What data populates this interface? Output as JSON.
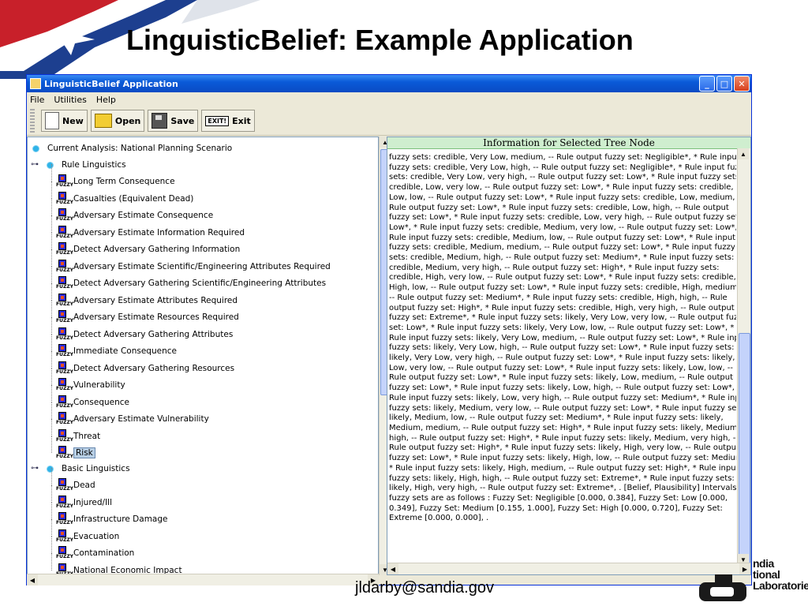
{
  "slide": {
    "title": "LinguisticBelief: Example Application",
    "footer_email": "jldarby@sandia.gov",
    "logo_text": [
      "ndia",
      "tional",
      "Laboratories"
    ]
  },
  "window": {
    "title": "LinguisticBelief Application",
    "menus": [
      "File",
      "Utilities",
      "Help"
    ],
    "toolbar": {
      "new_label": "New",
      "open_label": "Open",
      "save_label": "Save",
      "exit_icon_text": "EXIT!",
      "exit_label": "Exit"
    }
  },
  "tree": {
    "root": "Current Analysis: National Planning Scenario",
    "rule_group": "Rule Linguistics",
    "icon_text": "FUZZY",
    "rule_items": [
      "Long Term Consequence",
      "Casualties (Equivalent Dead)",
      "Adversary Estimate Consequence",
      "Adversary Estimate Information Required",
      "Detect Adversary Gathering Information",
      "Adversary Estimate Scientific/Engineering Attributes Required",
      "Detect Adversary Gathering Scientific/Engineering Attributes",
      "Adversary Estimate Attributes Required",
      "Adversary Estimate Resources Required",
      "Detect Adversary Gathering Attributes",
      "Immediate Consequence",
      "Detect Adversary Gathering Resources",
      "Vulnerability",
      "Consequence",
      "Adversary Estimate Vulnerability",
      "Threat",
      "Risk"
    ],
    "basic_group": "Basic Linguistics",
    "basic_items": [
      "Dead",
      "Injured/Ill",
      "Infrastructure Damage",
      "Evacuation",
      "Contamination",
      "National Economic Impact"
    ]
  },
  "info": {
    "header": "Information for Selected Tree Node",
    "lines": [
      "fuzzy sets: credible, Very Low, medium, -- Rule output fuzzy set: Negligible*, * Rule input",
      "fuzzy sets: credible, Very Low, high, -- Rule output fuzzy set: Negligible*, * Rule input fuzzy",
      "sets: credible, Very Low, very high, -- Rule output fuzzy set: Low*, * Rule input fuzzy sets:",
      "credible, Low, very low, -- Rule output fuzzy set: Low*, * Rule input fuzzy sets: credible,",
      "Low, low, -- Rule output fuzzy set: Low*, * Rule input fuzzy sets: credible, Low, medium, --",
      "Rule output fuzzy set: Low*, * Rule input fuzzy sets: credible, Low, high, -- Rule output",
      "fuzzy set: Low*, * Rule input fuzzy sets: credible, Low, very high, -- Rule output fuzzy set:",
      "Low*, * Rule input fuzzy sets: credible, Medium, very low, -- Rule output fuzzy set: Low*, *",
      "Rule input fuzzy sets: credible, Medium, low, -- Rule output fuzzy set: Low*, * Rule input",
      "fuzzy sets: credible, Medium, medium, -- Rule output fuzzy set: Low*, * Rule input fuzzy",
      "sets: credible, Medium, high, -- Rule output fuzzy set: Medium*, * Rule input fuzzy sets:",
      "credible, Medium, very high, -- Rule output fuzzy set: High*, * Rule input fuzzy sets:",
      "credible, High, very low, -- Rule output fuzzy set: Low*, * Rule input fuzzy sets: credible,",
      "High, low, -- Rule output fuzzy set: Low*, * Rule input fuzzy sets: credible, High, medium,",
      "-- Rule output fuzzy set: Medium*, * Rule input fuzzy sets: credible, High, high, -- Rule",
      "output fuzzy set: High*, * Rule input fuzzy sets: credible, High, very high, -- Rule output",
      "fuzzy set: Extreme*, * Rule input fuzzy sets: likely, Very Low, very low, -- Rule output fuzzy",
      "set: Low*, * Rule input fuzzy sets: likely, Very Low, low, -- Rule output fuzzy set: Low*, *",
      "Rule input fuzzy sets: likely, Very Low, medium, -- Rule output fuzzy set: Low*, * Rule input",
      "fuzzy sets: likely, Very Low, high, -- Rule output fuzzy set: Low*, * Rule input fuzzy sets:",
      "likely, Very Low, very high, -- Rule output fuzzy set: Low*, * Rule input fuzzy sets: likely,",
      "Low, very low, -- Rule output fuzzy set: Low*, * Rule input fuzzy sets: likely, Low, low, --",
      "Rule output fuzzy set: Low*, * Rule input fuzzy sets: likely, Low, medium, -- Rule output",
      "fuzzy set: Low*, * Rule input fuzzy sets: likely, Low, high, -- Rule output fuzzy set: Low*, *",
      "Rule input fuzzy sets: likely, Low, very high, -- Rule output fuzzy set: Medium*, * Rule input",
      "fuzzy sets: likely, Medium, very low, -- Rule output fuzzy set: Low*, * Rule input fuzzy sets:",
      "likely, Medium, low, -- Rule output fuzzy set: Medium*, * Rule input fuzzy sets: likely,",
      "Medium, medium, -- Rule output fuzzy set: High*, * Rule input fuzzy sets: likely, Medium,",
      "high, -- Rule output fuzzy set: High*, * Rule input fuzzy sets: likely, Medium, very high, --",
      "Rule output fuzzy set: High*, * Rule input fuzzy sets: likely, High, very low, -- Rule output",
      "fuzzy set: Low*, * Rule input fuzzy sets: likely, High, low, -- Rule output fuzzy set: Medium*,",
      "* Rule input fuzzy sets: likely, High, medium, -- Rule output fuzzy set: High*, * Rule input",
      "fuzzy sets: likely, High, high, -- Rule output fuzzy set: Extreme*, * Rule input fuzzy sets:",
      "likely, High, very high, -- Rule output fuzzy set: Extreme*, . [Belief, Plausibility] Intervals for",
      "fuzzy sets are as follows : Fuzzy Set: Negligible [0.000, 0.384], Fuzzy Set: Low [0.000,",
      "0.349], Fuzzy Set: Medium [0.155, 1.000], Fuzzy Set: High [0.000, 0.720], Fuzzy Set:",
      "Extreme [0.000, 0.000], ."
    ]
  }
}
